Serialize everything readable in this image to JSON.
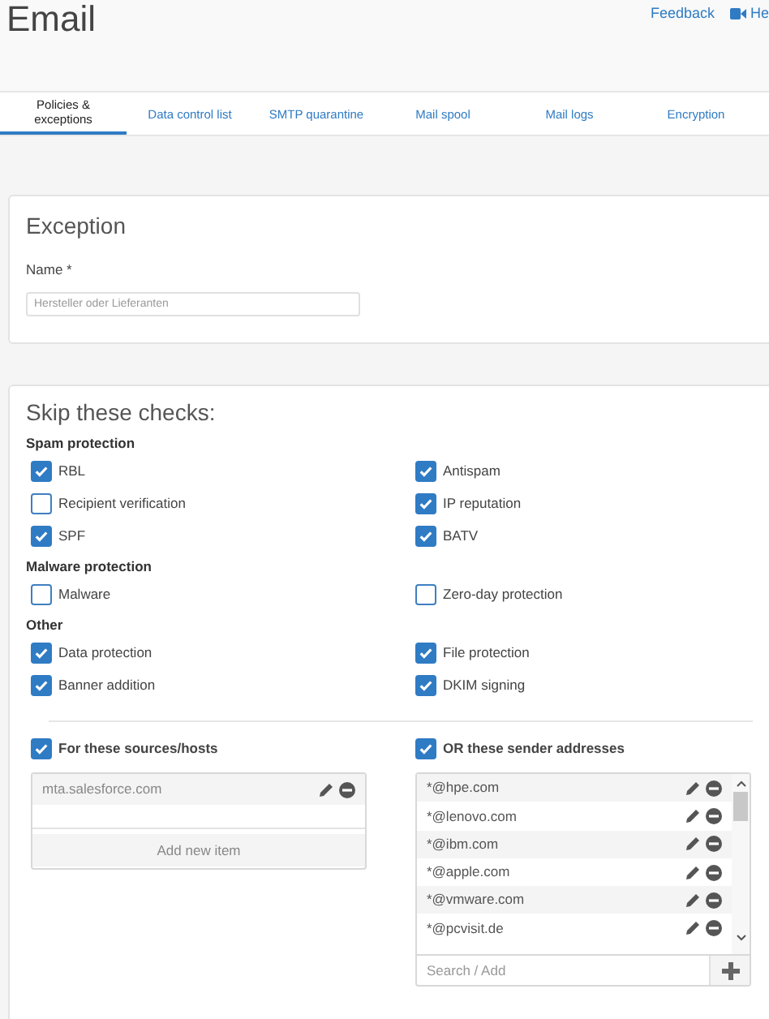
{
  "header": {
    "title": "Email",
    "links": [
      {
        "label": "Feedback",
        "kind": "text"
      },
      {
        "label": "He",
        "kind": "video"
      }
    ]
  },
  "tabs": [
    {
      "label": "Policies & exceptions",
      "selected": true
    },
    {
      "label": "Data control list",
      "selected": false
    },
    {
      "label": "SMTP quarantine",
      "selected": false
    },
    {
      "label": "Mail spool",
      "selected": false
    },
    {
      "label": "Mail logs",
      "selected": false
    },
    {
      "label": "Encryption",
      "selected": false
    }
  ],
  "exception": {
    "title": "Exception",
    "name_label": "Name *",
    "name_placeholder": "Hersteller oder Lieferanten"
  },
  "checks": {
    "title": "Skip these checks:",
    "groups": [
      {
        "label": "Spam protection",
        "items": [
          {
            "label": "RBL",
            "checked": true
          },
          {
            "label": "Antispam",
            "checked": true
          },
          {
            "label": "Recipient verification",
            "checked": false
          },
          {
            "label": "IP reputation",
            "checked": true
          },
          {
            "label": "SPF",
            "checked": true
          },
          {
            "label": "BATV",
            "checked": true
          }
        ]
      },
      {
        "label": "Malware protection",
        "items": [
          {
            "label": "Malware",
            "checked": false
          },
          {
            "label": "Zero-day protection",
            "checked": false
          }
        ]
      },
      {
        "label": "Other",
        "items": [
          {
            "label": "Data protection",
            "checked": true
          },
          {
            "label": "File protection",
            "checked": true
          },
          {
            "label": "Banner addition",
            "checked": true
          },
          {
            "label": "DKIM signing",
            "checked": true
          }
        ]
      }
    ]
  },
  "sources": {
    "label": "For these sources/hosts",
    "checked": true,
    "items": [
      "mta.salesforce.com"
    ],
    "add_label": "Add new item"
  },
  "senders": {
    "label": "OR these sender addresses",
    "checked": true,
    "items": [
      "*@hpe.com",
      "*@lenovo.com",
      "*@ibm.com",
      "*@apple.com",
      "*@vmware.com",
      "*@pcvisit.de"
    ],
    "search_placeholder": "Search / Add"
  }
}
